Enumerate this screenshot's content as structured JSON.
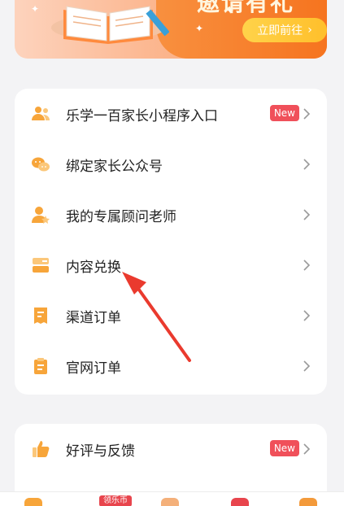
{
  "banner": {
    "title": "邀请有礼",
    "go_label": "立即前往",
    "go_chevron": "›"
  },
  "menu_main": [
    {
      "label": "乐学一百家长小程序入口",
      "badge": "New",
      "icon": "parents-icon"
    },
    {
      "label": "绑定家长公众号",
      "badge": "",
      "icon": "wechat-icon"
    },
    {
      "label": "我的专属顾问老师",
      "badge": "",
      "icon": "advisor-icon"
    },
    {
      "label": "内容兑换",
      "badge": "",
      "icon": "exchange-icon"
    },
    {
      "label": "渠道订单",
      "badge": "",
      "icon": "receipt-icon"
    },
    {
      "label": "官网订单",
      "badge": "",
      "icon": "clipboard-icon"
    }
  ],
  "menu_secondary": [
    {
      "label": "好评与反馈",
      "badge": "New",
      "icon": "thumbs-up-icon"
    }
  ],
  "bottom_nav": {
    "coin_badge": "领乐币"
  },
  "colors": {
    "accent": "#f7a53a",
    "badge": "#f0505a",
    "banner": "#f7741f"
  }
}
